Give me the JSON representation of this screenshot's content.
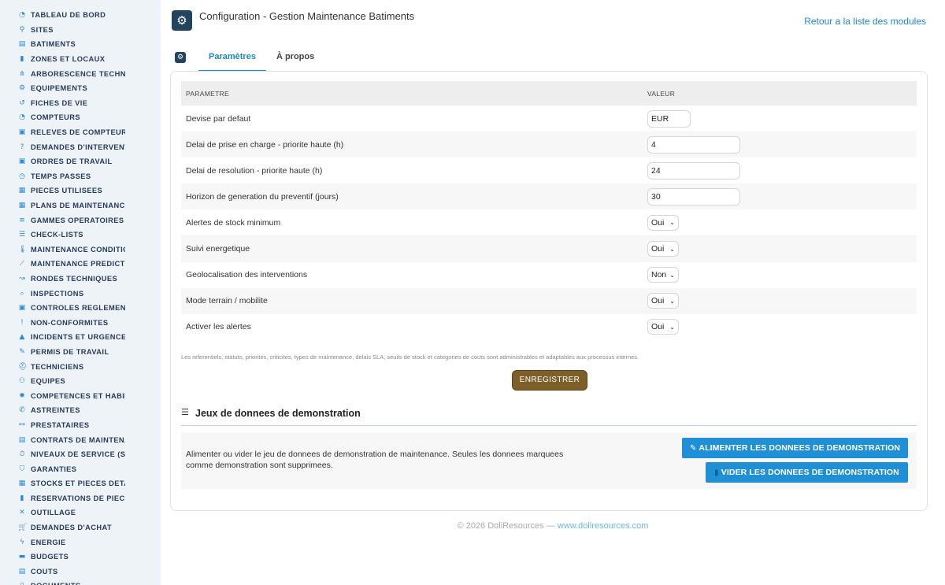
{
  "sidebar": {
    "items": [
      {
        "label": "TABLEAU DE BORD",
        "icon": "dashboard-icon",
        "glyph": "◔"
      },
      {
        "label": "SITES",
        "icon": "map-pin-icon",
        "glyph": "⚲"
      },
      {
        "label": "BATIMENTS",
        "icon": "building-icon",
        "glyph": "▤"
      },
      {
        "label": "ZONES ET LOCAUX",
        "icon": "door-icon",
        "glyph": "▮"
      },
      {
        "label": "ARBORESCENCE TECHNI",
        "icon": "sitemap-icon",
        "glyph": "⋔"
      },
      {
        "label": "EQUIPEMENTS",
        "icon": "cogs-icon",
        "glyph": "⚙"
      },
      {
        "label": "FICHES DE VIE",
        "icon": "history-icon",
        "glyph": "↺"
      },
      {
        "label": "COMPTEURS",
        "icon": "gauge-icon",
        "glyph": "◔"
      },
      {
        "label": "RELEVES DE COMPTEURS",
        "icon": "clipboard-icon",
        "glyph": "▣"
      },
      {
        "label": "DEMANDES D'INTERVENT",
        "icon": "question-circle-icon",
        "glyph": "?"
      },
      {
        "label": "ORDRES DE TRAVAIL",
        "icon": "clipboard-check-icon",
        "glyph": "▣"
      },
      {
        "label": "TEMPS PASSES",
        "icon": "clock-icon",
        "glyph": "◷"
      },
      {
        "label": "PIECES UTILISEES",
        "icon": "boxes-icon",
        "glyph": "▦"
      },
      {
        "label": "PLANS DE MAINTENANCE",
        "icon": "calendar-icon",
        "glyph": "▦"
      },
      {
        "label": "GAMMES OPERATOIRES",
        "icon": "list-icon",
        "glyph": "≡"
      },
      {
        "label": "CHECK-LISTS",
        "icon": "checklist-icon",
        "glyph": "☰"
      },
      {
        "label": "MAINTENANCE CONDITIO",
        "icon": "thermometer-icon",
        "glyph": "🌡"
      },
      {
        "label": "MAINTENANCE PREDICTI",
        "icon": "chart-line-icon",
        "glyph": "⟋"
      },
      {
        "label": "RONDES TECHNIQUES",
        "icon": "route-icon",
        "glyph": "↝"
      },
      {
        "label": "INSPECTIONS",
        "icon": "search-icon",
        "glyph": "⌕"
      },
      {
        "label": "CONTROLES REGLEMENT",
        "icon": "clipboard-list-icon",
        "glyph": "▣"
      },
      {
        "label": "NON-CONFORMITES",
        "icon": "exclamation-circle-icon",
        "glyph": "!"
      },
      {
        "label": "INCIDENTS ET URGENCES",
        "icon": "warning-icon",
        "glyph": "▲"
      },
      {
        "label": "PERMIS DE TRAVAIL",
        "icon": "file-signature-icon",
        "glyph": "✎"
      },
      {
        "label": "TECHNICIENS",
        "icon": "hard-hat-icon",
        "glyph": "⛑"
      },
      {
        "label": "EQUIPES",
        "icon": "users-icon",
        "glyph": "⚇"
      },
      {
        "label": "COMPETENCES ET HABIL",
        "icon": "certificate-icon",
        "glyph": "✹"
      },
      {
        "label": "ASTREINTES",
        "icon": "phone-icon",
        "glyph": "✆"
      },
      {
        "label": "PRESTATAIRES",
        "icon": "handshake-icon",
        "glyph": "⚯"
      },
      {
        "label": "CONTRATS DE MAINTENA",
        "icon": "file-contract-icon",
        "glyph": "▤"
      },
      {
        "label": "NIVEAUX DE SERVICE (SL",
        "icon": "stopwatch-icon",
        "glyph": "⏱"
      },
      {
        "label": "GARANTIES",
        "icon": "shield-icon",
        "glyph": "⛉"
      },
      {
        "label": "STOCKS ET PIECES DETA",
        "icon": "cubes-icon",
        "glyph": "▦"
      },
      {
        "label": "RESERVATIONS DE PIECE",
        "icon": "bookmark-icon",
        "glyph": "▮"
      },
      {
        "label": "OUTILLAGE",
        "icon": "tools-icon",
        "glyph": "✕"
      },
      {
        "label": "DEMANDES D'ACHAT",
        "icon": "cart-icon",
        "glyph": "🛒"
      },
      {
        "label": "ENERGIE",
        "icon": "bolt-icon",
        "glyph": "ϟ"
      },
      {
        "label": "BUDGETS",
        "icon": "money-icon",
        "glyph": "▬"
      },
      {
        "label": "COUTS",
        "icon": "coins-icon",
        "glyph": "▤"
      },
      {
        "label": "DOCUMENTS",
        "icon": "file-icon",
        "glyph": "▯"
      }
    ]
  },
  "header": {
    "title": "Configuration - Gestion Maintenance Batiments",
    "back_link": "Retour a la liste des modules",
    "module_icon_glyph": "⚙"
  },
  "tabs": [
    {
      "label": "Paramètres",
      "active": true
    },
    {
      "label": "À propos",
      "active": false
    }
  ],
  "params": {
    "col_param": "PARAMETRE",
    "col_value": "VALEUR",
    "rows": [
      {
        "label": "Devise par defaut",
        "kind": "input-cur",
        "value": "EUR"
      },
      {
        "label": "Delai de prise en charge - priorite haute (h)",
        "kind": "input-num",
        "value": "4"
      },
      {
        "label": "Delai de resolution - priorite haute (h)",
        "kind": "input-num",
        "value": "24"
      },
      {
        "label": "Horizon de generation du preventif (jours)",
        "kind": "input-num",
        "value": "30"
      },
      {
        "label": "Alertes de stock minimum",
        "kind": "select",
        "value": "Oui"
      },
      {
        "label": "Suivi energetique",
        "kind": "select",
        "value": "Oui"
      },
      {
        "label": "Geolocalisation des interventions",
        "kind": "select",
        "value": "Non"
      },
      {
        "label": "Mode terrain / mobilite",
        "kind": "select",
        "value": "Oui"
      },
      {
        "label": "Activer les alertes",
        "kind": "select",
        "value": "Oui"
      }
    ],
    "note": "Les referentiels, statuts, priorites, criticites, types de maintenance, delais SLA, seuils de stock et categories de couts sont administrables et adaptables aux processus internes.",
    "save_label": "ENREGISTRER"
  },
  "demo": {
    "title": "Jeux de donnees de demonstration",
    "text": "Alimenter ou vider le jeu de donnees de demonstration de maintenance. Seules les donnees marquees comme demonstration sont supprimees.",
    "feed_label": "ALIMENTER LES DONNEES DE DEMONSTRATION",
    "clear_label": "VIDER LES DONNEES DE DEMONSTRATION"
  },
  "footer": {
    "copyright": "© 2026 DoliResources —",
    "link": "www.doliresources.com"
  },
  "colors": {
    "accent": "#1e88c8",
    "save_button": "#7d5f2a",
    "demo_button": "#1f8fd6",
    "sidebar_bg": "#eef3f8"
  }
}
